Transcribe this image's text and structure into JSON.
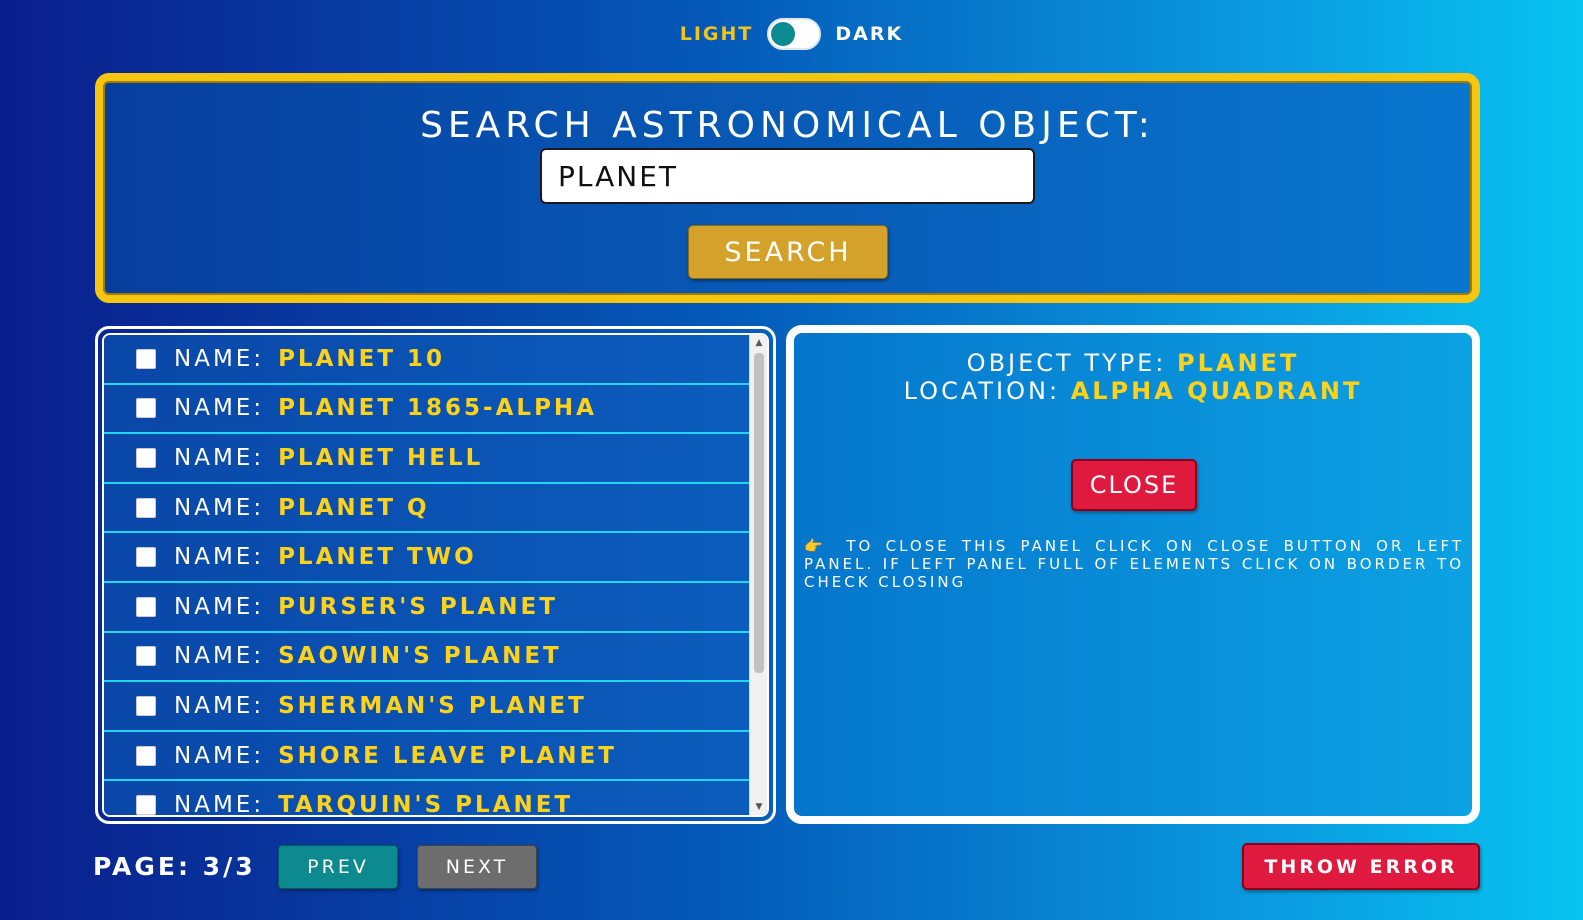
{
  "theme": {
    "light_label": "LIGHT",
    "dark_label": "DARK",
    "mode": "light"
  },
  "search": {
    "title": "SEARCH ASTRONOMICAL OBJECT:",
    "value": "PLANET",
    "button_label": "SEARCH"
  },
  "results": {
    "name_label": "NAME:",
    "items": [
      {
        "name": "PLANET 10",
        "checked": false
      },
      {
        "name": "PLANET 1865-ALPHA",
        "checked": false
      },
      {
        "name": "PLANET HELL",
        "checked": false
      },
      {
        "name": "PLANET Q",
        "checked": false
      },
      {
        "name": "PLANET TWO",
        "checked": false
      },
      {
        "name": "PURSER'S PLANET",
        "checked": false
      },
      {
        "name": "SAOWIN'S PLANET",
        "checked": false
      },
      {
        "name": "SHERMAN'S PLANET",
        "checked": false
      },
      {
        "name": "SHORE LEAVE PLANET",
        "checked": false
      },
      {
        "name": "TARQUIN'S PLANET",
        "checked": false
      }
    ]
  },
  "detail": {
    "type_label": "OBJECT TYPE:",
    "type_value": "PLANET",
    "location_label": "LOCATION:",
    "location_value": "ALPHA QUADRANT",
    "close_label": "CLOSE",
    "hint_icon": "pointing-hand-icon",
    "hint_glyph": "👉",
    "hint_text": "TO CLOSE THIS PANEL CLICK ON CLOSE BUTTON OR LEFT PANEL. IF LEFT PANEL FULL OF ELEMENTS CLICK ON BORDER TO CHECK CLOSING"
  },
  "pagination": {
    "page_label": "PAGE: 3/3",
    "prev_label": "PREV",
    "next_label": "NEXT"
  },
  "error_button_label": "THROW ERROR",
  "colors": {
    "accent_yellow": "#ffd21a",
    "frame_yellow": "#f5c60f",
    "danger_red": "#e0193f",
    "teal": "#0c8a8f",
    "gray": "#6d6d6d",
    "divider_cyan": "#22d6f0"
  }
}
